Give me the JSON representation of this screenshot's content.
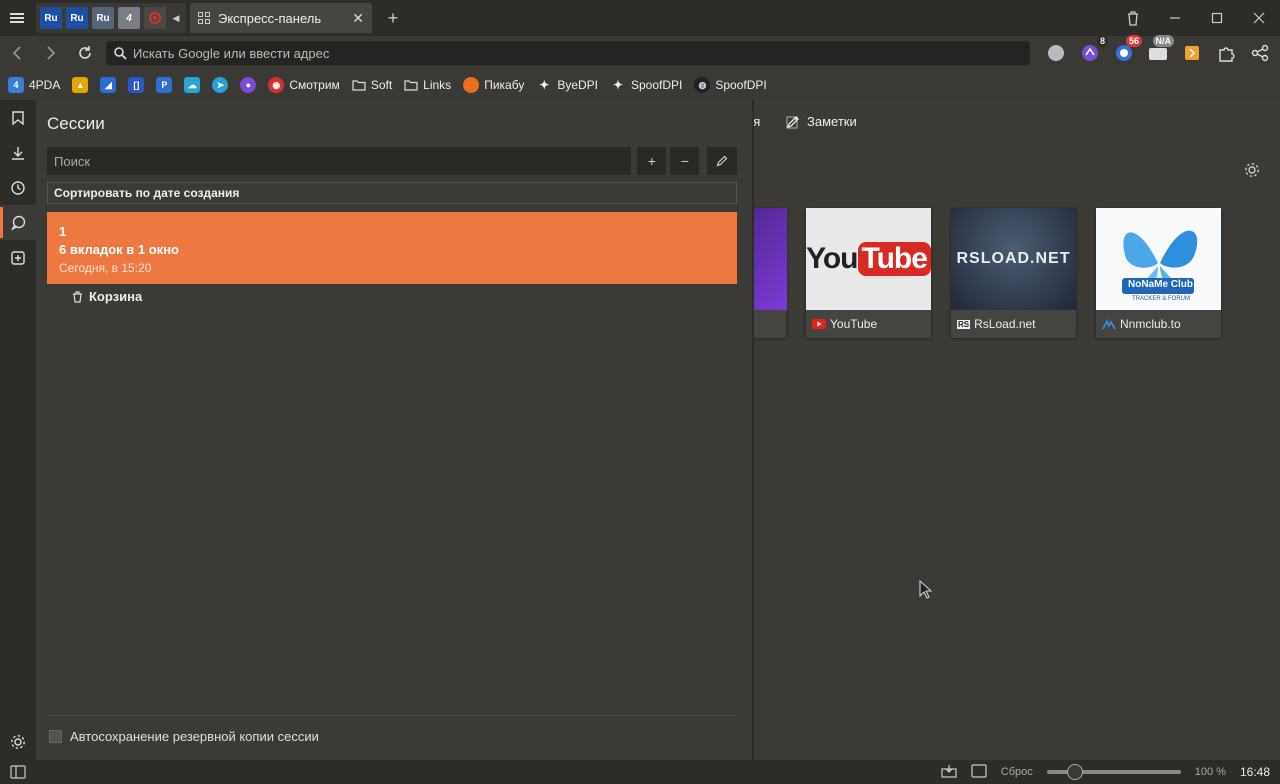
{
  "tabbar": {
    "stack_tabs": [
      {
        "label": "Ru",
        "color": "#1d4fa0"
      },
      {
        "label": "Ru",
        "color": "#1d4fa0"
      },
      {
        "label": "Ru",
        "color": "#56647a"
      },
      {
        "label": "4",
        "color": "#7a7e86"
      },
      {
        "label": "",
        "color": "#555"
      }
    ],
    "active_tab_title": "Экспресс-панель",
    "close_symbol": "✕",
    "new_tab_symbol": "+"
  },
  "addressbar": {
    "placeholder": "Искать Google или ввести адрес",
    "extensions": [
      {
        "name": "circle-extension-icon",
        "badge": "",
        "color": "#bbb"
      },
      {
        "name": "purple-extension-icon",
        "badge": "8",
        "color": "#7a4bd6",
        "badge_bg": "#2d2c29"
      },
      {
        "name": "blue-extension-icon",
        "badge": "56",
        "color": "#3a6fd9",
        "badge_bg": "#d9383a"
      },
      {
        "name": "na-extension-icon",
        "badge": "N/A",
        "color": "#ddd",
        "badge_bg": "#888"
      },
      {
        "name": "orange-extension-icon",
        "badge": "",
        "color": "#f0a030"
      },
      {
        "name": "puzzle-icon",
        "badge": "",
        "color": "#ddd"
      },
      {
        "name": "share-icon",
        "badge": "",
        "color": "#ddd"
      }
    ]
  },
  "bookmarks": [
    {
      "label": "4PDA",
      "icon": "4pda-icon",
      "color": "#3a7bd5",
      "glyph": "4"
    },
    {
      "label": "",
      "icon": "image-bookmark-icon",
      "color": "#e6a400",
      "glyph": "▲"
    },
    {
      "label": "",
      "icon": "swoosh-bookmark-icon",
      "color": "#2a6cd6",
      "glyph": "◢"
    },
    {
      "label": "",
      "icon": "bracket-bookmark-icon",
      "color": "#2b55c9",
      "glyph": "[]"
    },
    {
      "label": "",
      "icon": "p-bookmark-icon",
      "color": "#2f6fd0",
      "glyph": "P"
    },
    {
      "label": "",
      "icon": "cloud-bookmark-icon",
      "color": "#2aa4d8",
      "glyph": "☁"
    },
    {
      "label": "",
      "icon": "telegram-icon",
      "color": "#2b9fd8",
      "glyph": "➤"
    },
    {
      "label": "",
      "icon": "record-bookmark-icon",
      "color": "#7a4bd6",
      "glyph": "●"
    },
    {
      "label": "Смотрим",
      "icon": "smotrim-icon",
      "color": "#d0342c",
      "glyph": "◉"
    },
    {
      "label": "Soft",
      "icon": "folder-icon",
      "color": "transparent",
      "glyph": "▭"
    },
    {
      "label": "Links",
      "icon": "folder-icon",
      "color": "transparent",
      "glyph": "▭"
    },
    {
      "label": "Пикабу",
      "icon": "pikabu-icon",
      "color": "#e8701f",
      "glyph": "●"
    },
    {
      "label": "ByeDPI",
      "icon": "bird-icon",
      "color": "transparent",
      "glyph": "✦"
    },
    {
      "label": "SpoofDPI",
      "icon": "bird-icon",
      "color": "transparent",
      "glyph": "✦"
    },
    {
      "label": "SpoofDPI",
      "icon": "github-icon",
      "color": "transparent",
      "glyph": "◍"
    }
  ],
  "speeddial": {
    "tab_partial": "ия",
    "notes_label": "Заметки",
    "tiles": [
      {
        "caption": "YouTube",
        "favicon": "youtube-icon",
        "thumb": "youtube"
      },
      {
        "caption": "RsLoad.net",
        "favicon": "rsload-icon",
        "thumb": "rsload"
      },
      {
        "caption": "Nnmclub.to",
        "favicon": "nnmclub-icon",
        "thumb": "nnmclub"
      }
    ],
    "thumb_texts": {
      "youtube": "YouTube",
      "rsload": "RSLOAD.NET",
      "nnmclub": "NoNaMe Club",
      "nnmclub_sub": "TRACKER & FORUM"
    }
  },
  "sessions_panel": {
    "title": "Сессии",
    "search_placeholder": "Поиск",
    "add_symbol": "+",
    "remove_symbol": "−",
    "sort_label": "Сортировать по дате создания",
    "session": {
      "name": "1",
      "details": "6 вкладок в 1 окно",
      "date": "Сегодня, в 15:20"
    },
    "trash_label": "Корзина",
    "autosave_label": "Автосохранение резервной копии сессии",
    "autosave_checked": false
  },
  "statusbar": {
    "reset_label": "Сброс",
    "zoom_percent": "100 %",
    "zoom_value": 100,
    "clock": "16:48"
  },
  "colors": {
    "accent": "#ed7841",
    "background": "#3c3a36",
    "chrome": "#2d2c29"
  }
}
